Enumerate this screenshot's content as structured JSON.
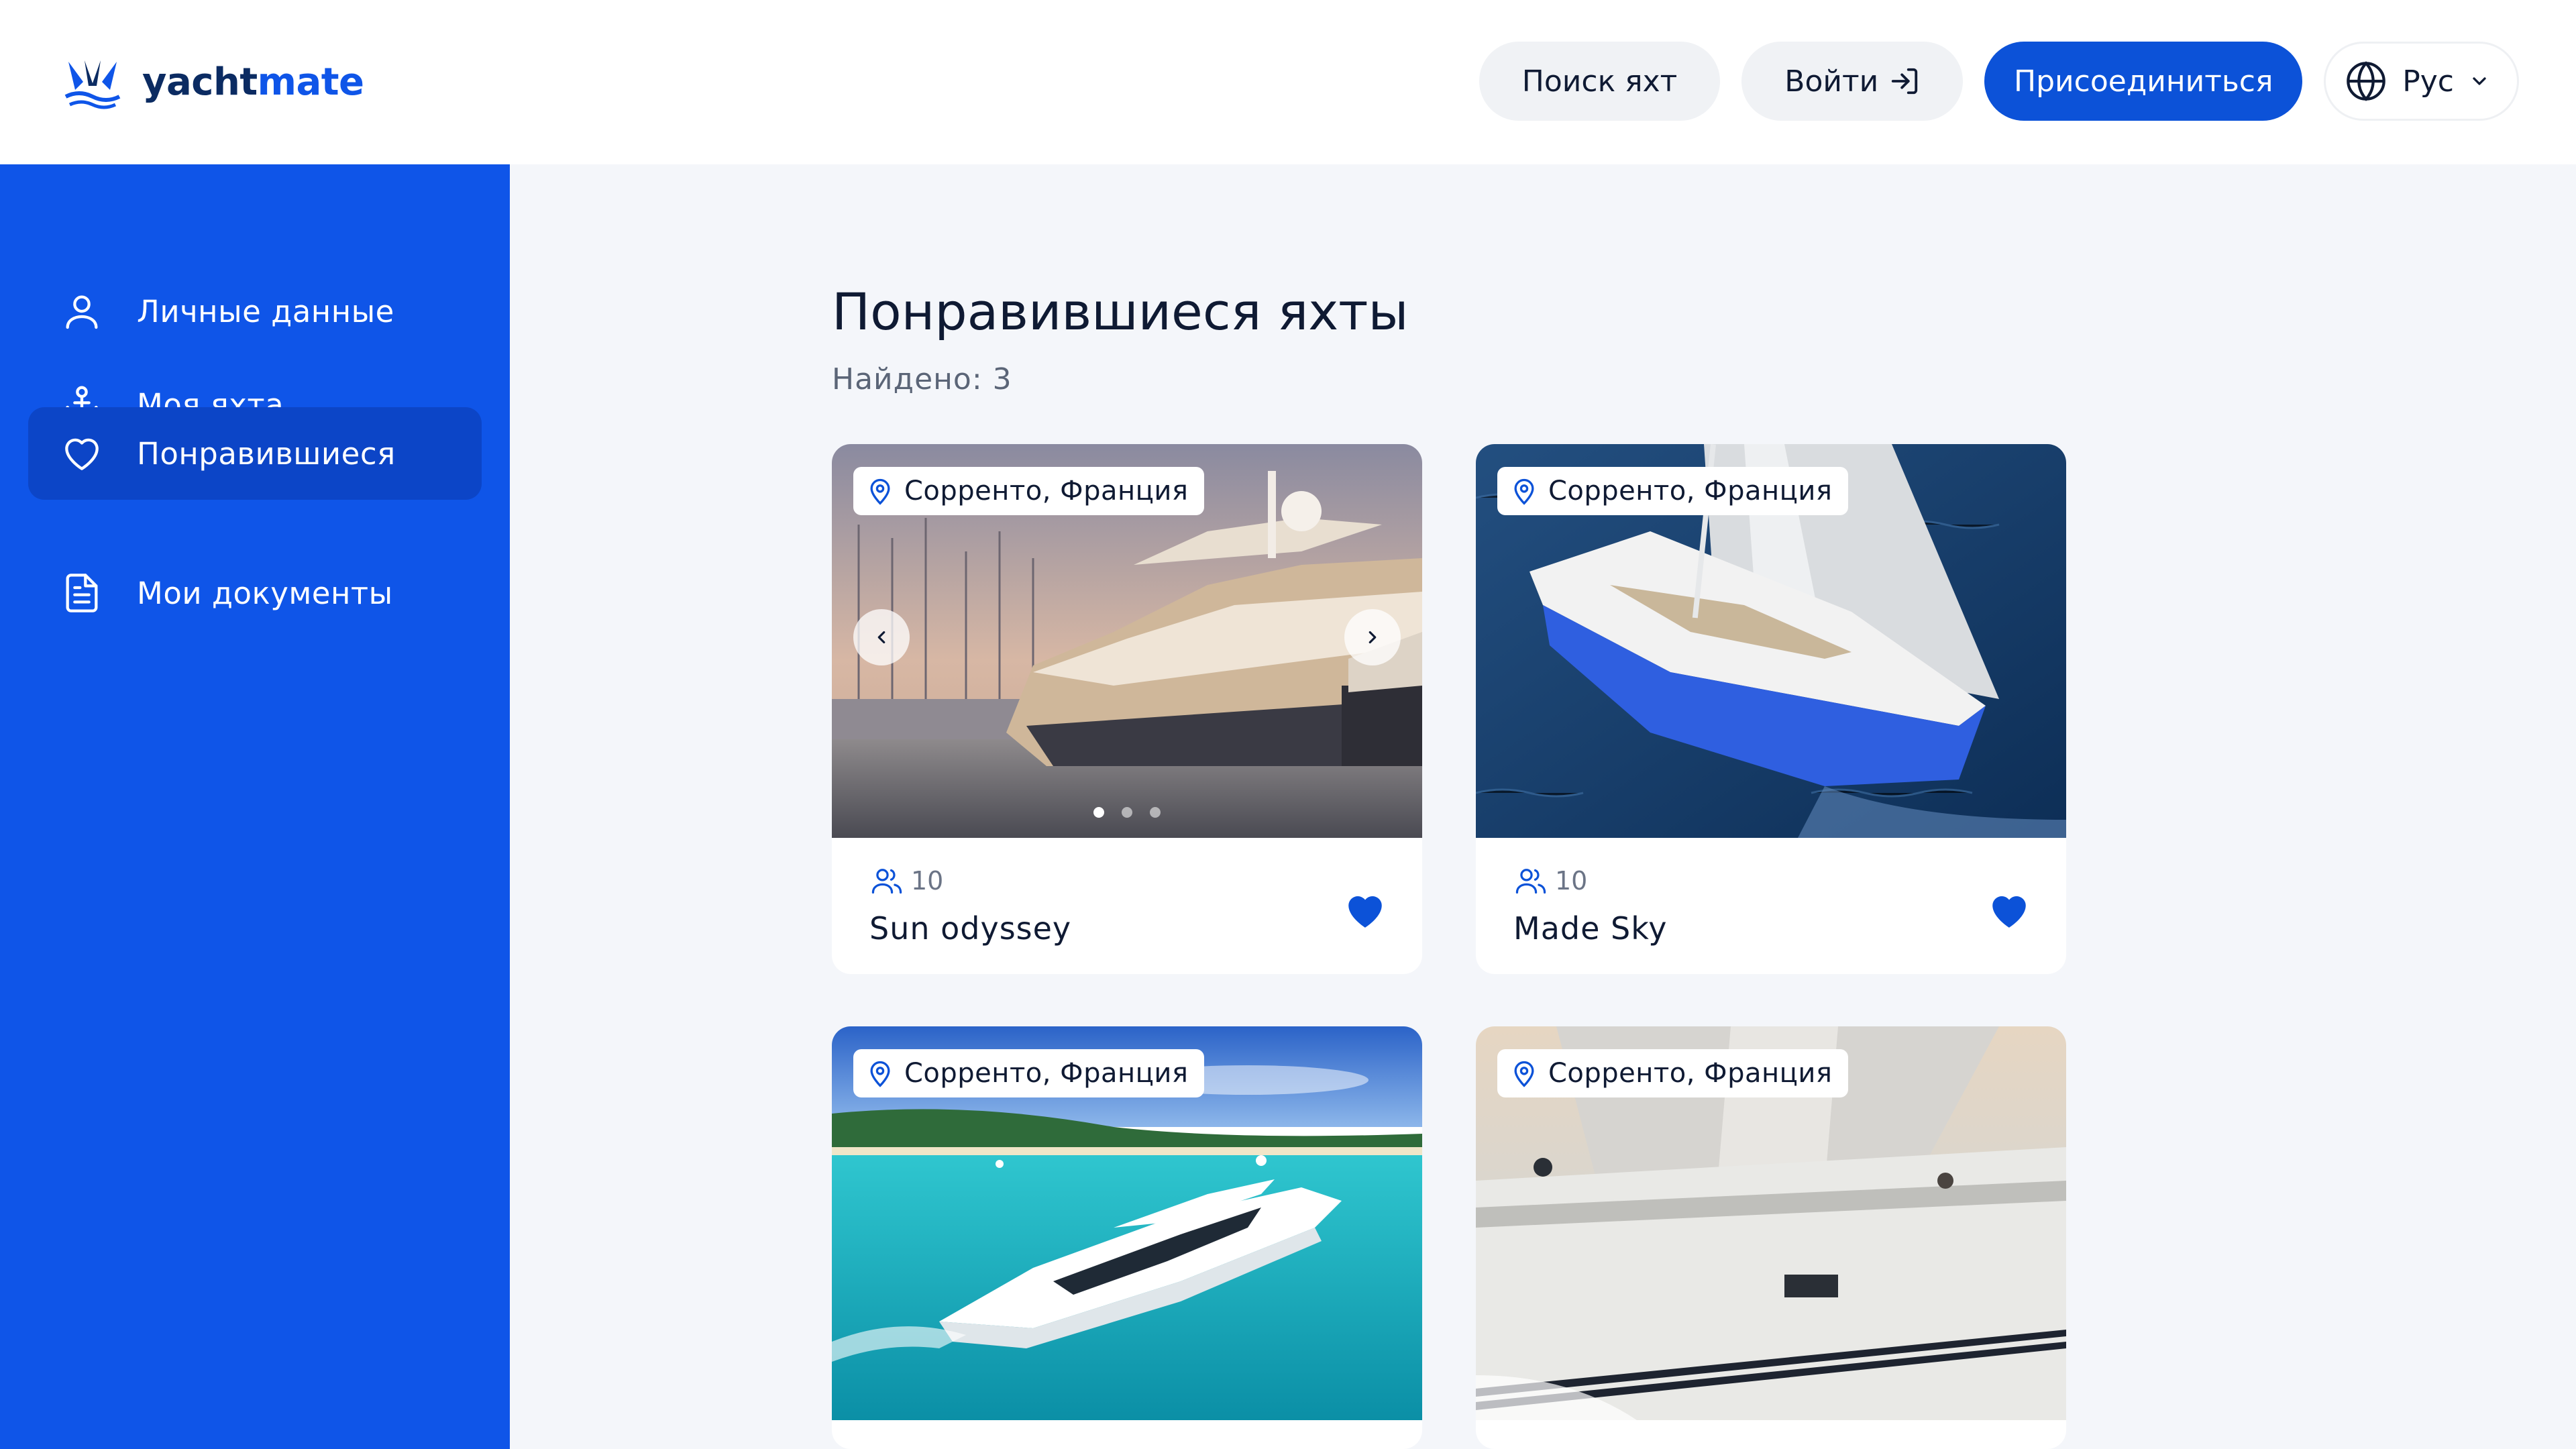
{
  "header": {
    "logo_prefix": "yacht",
    "logo_suffix": "mate",
    "search_label": "Поиск яхт",
    "login_label": "Войти",
    "join_label": "Присоединиться",
    "language_label": "Рус"
  },
  "sidebar": {
    "items": [
      {
        "label": "Личные данные",
        "icon": "user-icon",
        "active": false
      },
      {
        "label": "Моя яхта",
        "icon": "anchor-icon",
        "active": false
      },
      {
        "label": "Понравившиеся",
        "icon": "heart-icon",
        "active": true
      },
      {
        "label": "Мои документы",
        "icon": "document-icon",
        "active": false
      }
    ]
  },
  "main": {
    "title": "Понравившиеся яхты",
    "found": "Найдено: 3"
  },
  "cards": [
    {
      "location": "Сорренто, Франция",
      "guests": "10",
      "name": "Sun odyssey",
      "liked": true,
      "carousel_dots": 3,
      "active_dot": 1
    },
    {
      "location": "Сорренто, Франция",
      "guests": "10",
      "name": "Made Sky",
      "liked": true
    },
    {
      "location": "Сорренто, Франция"
    },
    {
      "location": "Сорренто, Франция"
    }
  ],
  "colors": {
    "brand_blue": "#0f55e8",
    "sidebar_active": "#0c45c7",
    "join_button": "#0c52d8",
    "heart": "#0c52d8",
    "page_bg": "#f4f6fa"
  }
}
